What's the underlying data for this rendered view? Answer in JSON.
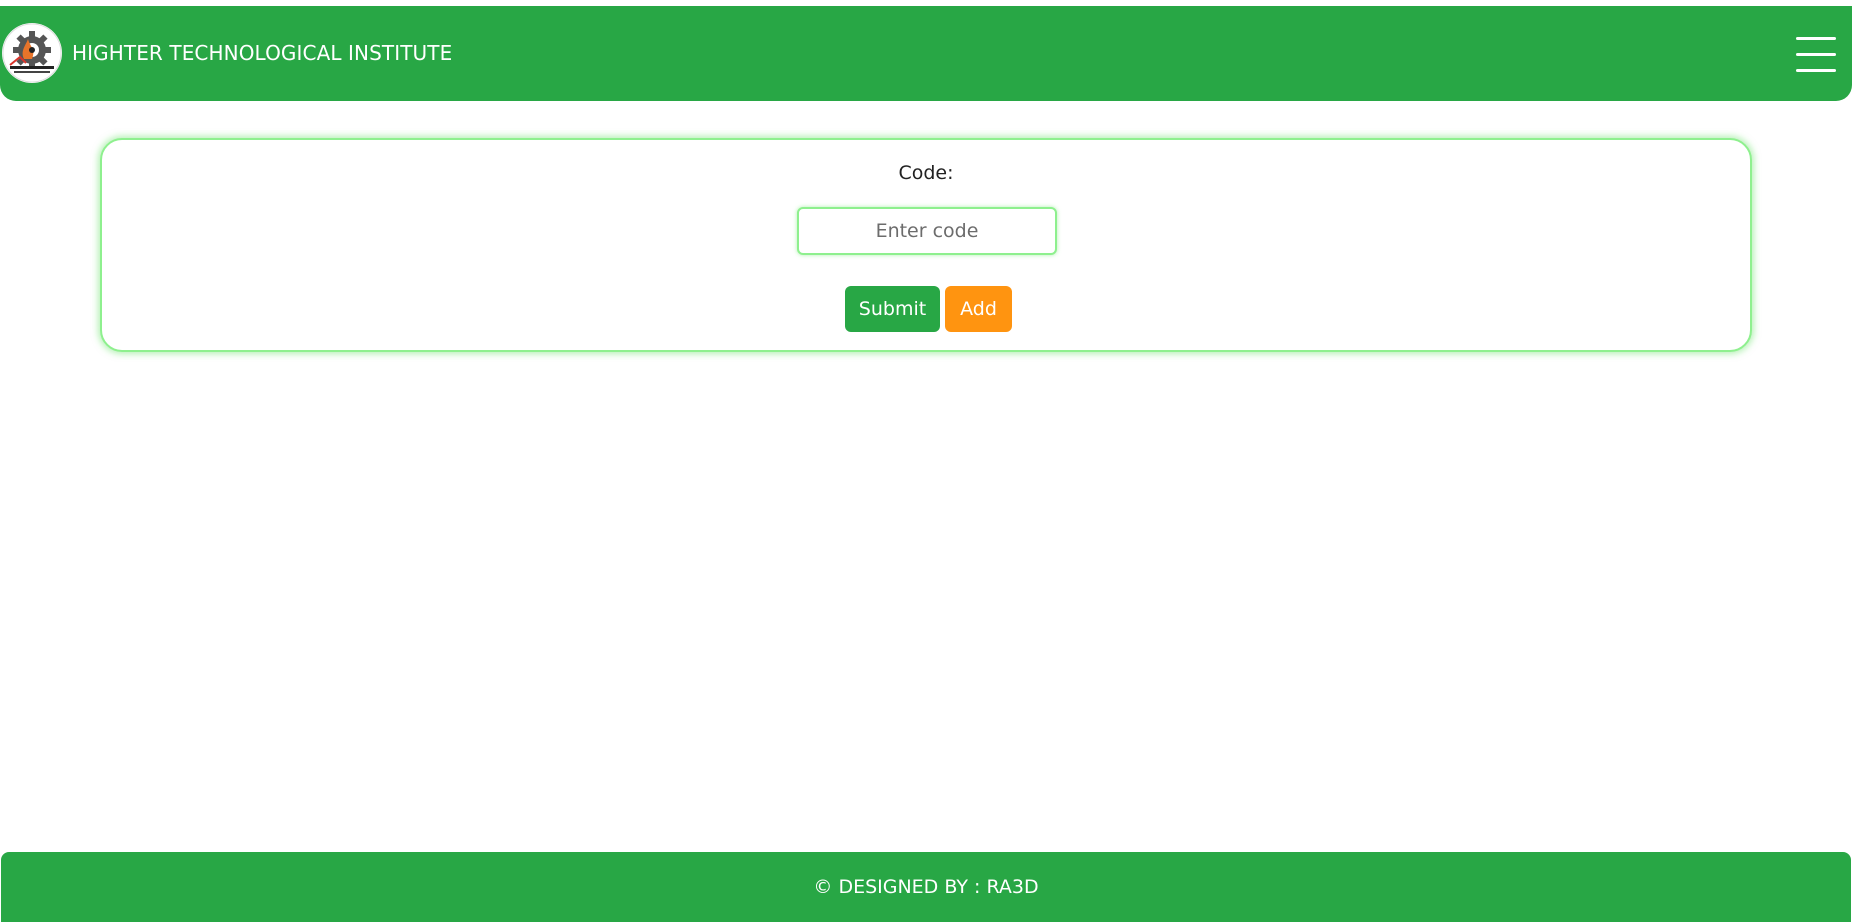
{
  "header": {
    "brand": "HIGHTER TECHNOLOGICAL INSTITUTE",
    "logo_icon": "institute-gear-logo",
    "menu_icon": "hamburger-menu-icon"
  },
  "form": {
    "code_label": "Code:",
    "code_input_placeholder": "Enter code",
    "code_input_value": "",
    "submit_label": "Submit",
    "add_label": "Add"
  },
  "footer": {
    "text": "© DESIGNED BY : RA3D"
  },
  "colors": {
    "primary": "#28a745",
    "accent": "#ff9410",
    "card_border": "#8ef08e"
  }
}
